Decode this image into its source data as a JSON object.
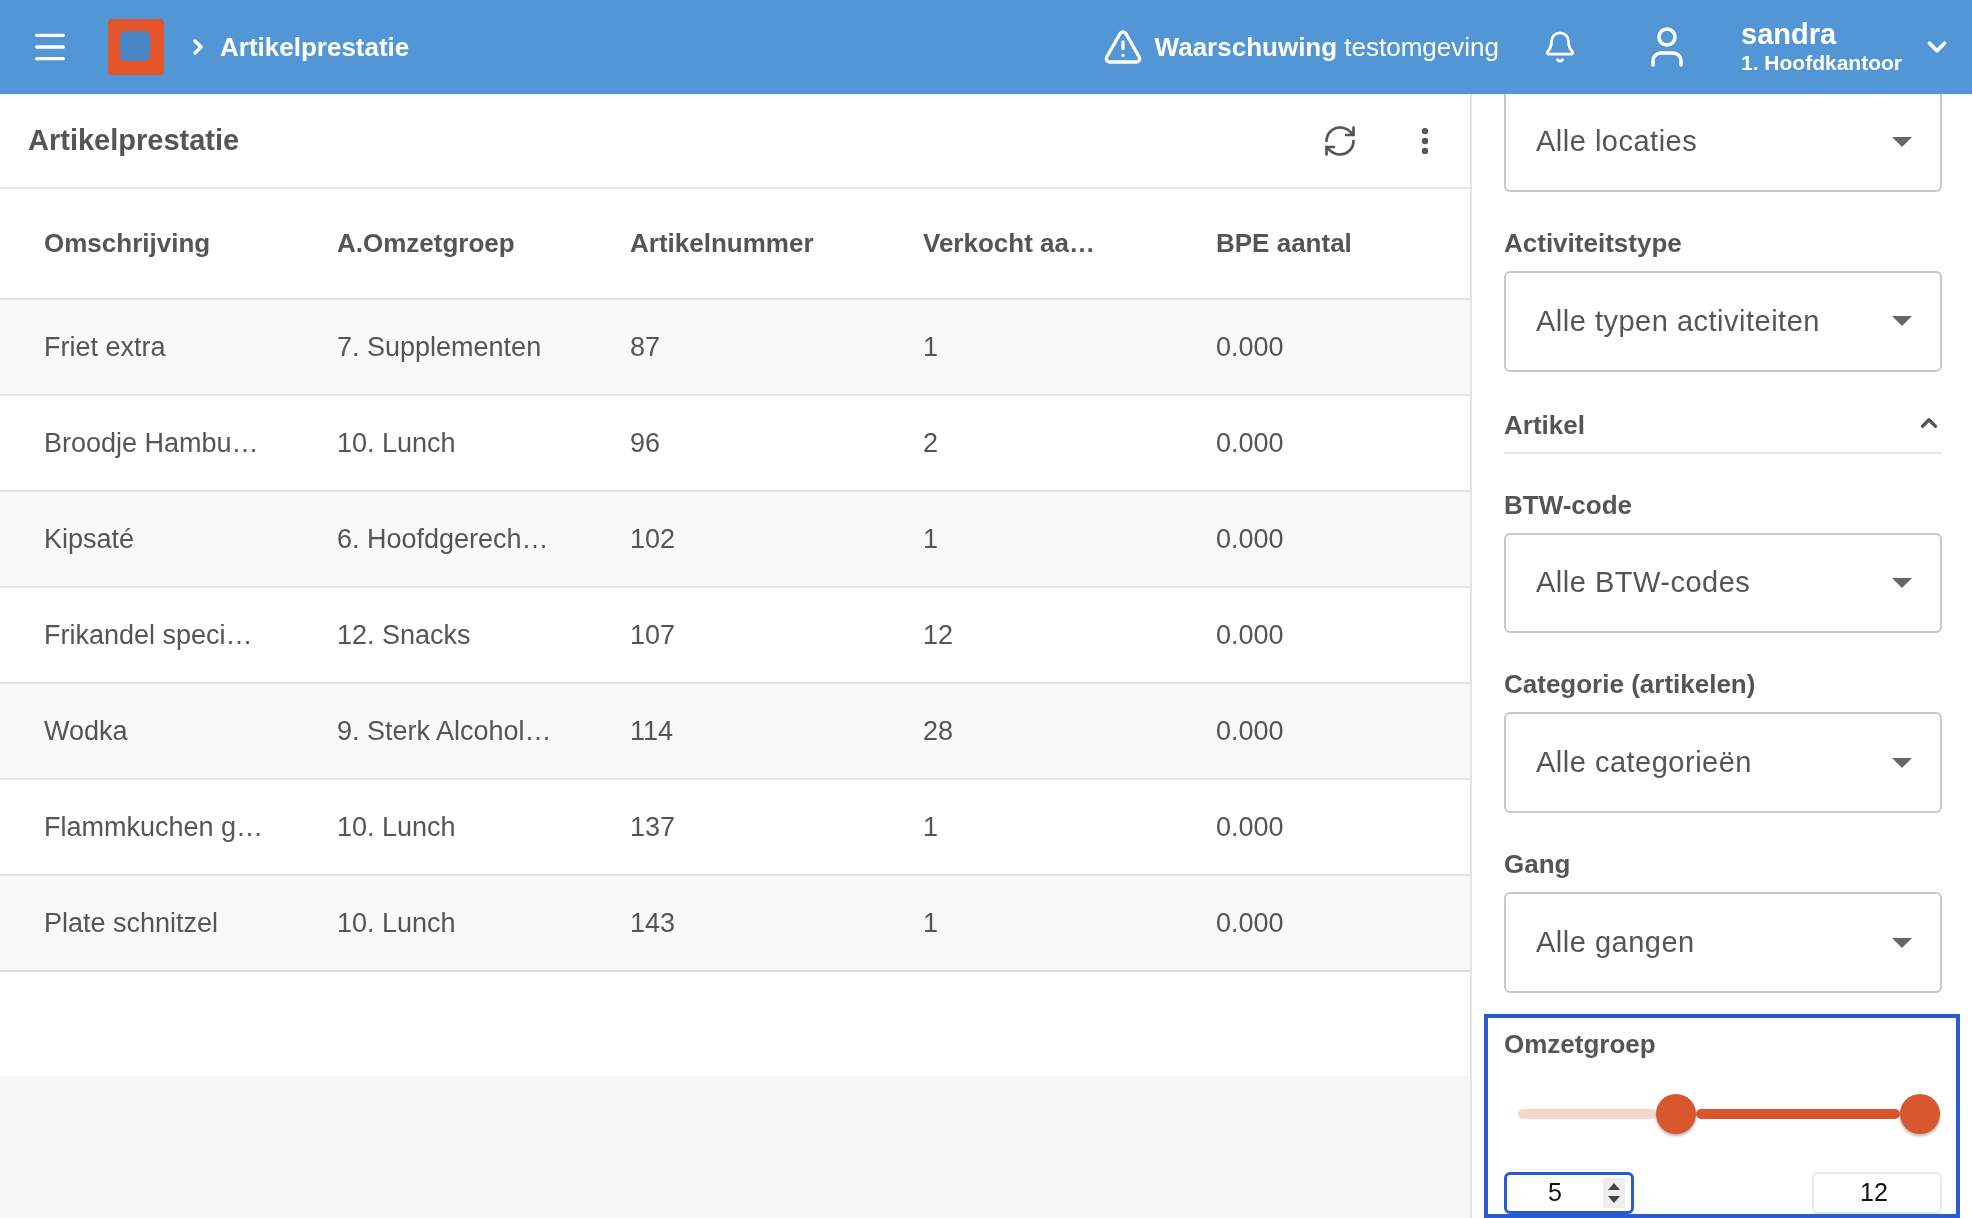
{
  "header": {
    "breadcrumb": "Artikelprestatie",
    "warning": "**Waarschuwing** testomgeving",
    "user": {
      "name": "sandra",
      "location": "1. Hoofdkantoor"
    }
  },
  "page": {
    "title": "Artikelprestatie"
  },
  "table": {
    "columns": [
      "Omschrijving",
      "A.Omzetgroep",
      "Artikelnummer",
      "Verkocht aa…",
      "BPE aantal"
    ],
    "rows": [
      [
        "Friet extra",
        "7. Supplementen",
        "87",
        "1",
        "0.000"
      ],
      [
        "Broodje Hambu…",
        "10. Lunch",
        "96",
        "2",
        "0.000"
      ],
      [
        "Kipsaté",
        "6. Hoofdgerech…",
        "102",
        "1",
        "0.000"
      ],
      [
        "Frikandel speci…",
        "12. Snacks",
        "107",
        "12",
        "0.000"
      ],
      [
        "Wodka",
        "9. Sterk Alcohol…",
        "114",
        "28",
        "0.000"
      ],
      [
        "Flammkuchen g…",
        "10. Lunch",
        "137",
        "1",
        "0.000"
      ],
      [
        "Plate schnitzel",
        "10. Lunch",
        "143",
        "1",
        "0.000"
      ]
    ]
  },
  "filters": [
    {
      "kind": "dropdown",
      "value": "Alle locaties"
    },
    {
      "kind": "dropdown",
      "label": "Activiteitstype",
      "value": "Alle typen activiteiten"
    },
    {
      "kind": "section",
      "title": "Artikel",
      "expanded": true
    },
    {
      "kind": "dropdown",
      "label": "BTW-code",
      "value": "Alle BTW-codes"
    },
    {
      "kind": "dropdown",
      "label": "Categorie (artikelen)",
      "value": "Alle categorieën"
    },
    {
      "kind": "dropdown",
      "label": "Gang",
      "value": "Alle gangen"
    },
    {
      "kind": "range",
      "label": "Omzetgroep",
      "highlighted": true,
      "thumbs": [
        {
          "level": 0.36
        },
        {
          "level": 1
        }
      ],
      "inputs": [
        {
          "value": "5",
          "focused": true
        },
        {
          "value": "12",
          "focused": false
        }
      ]
    }
  ]
}
